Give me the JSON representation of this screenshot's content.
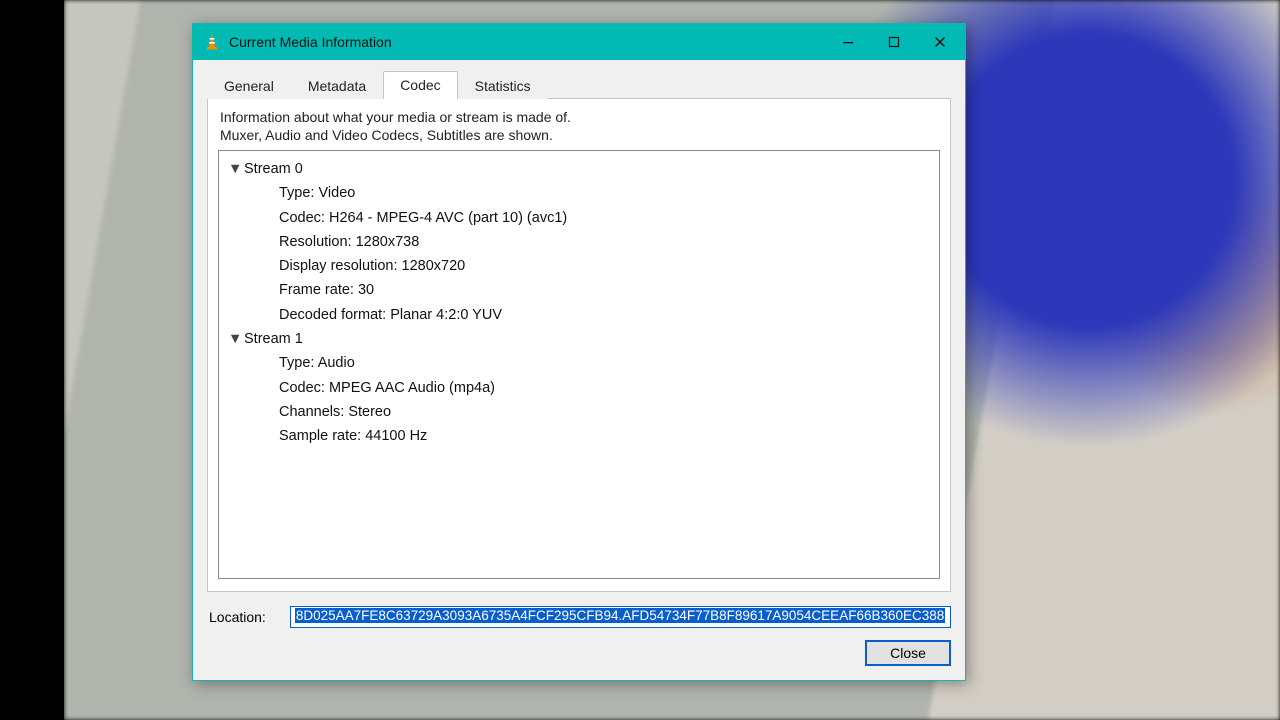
{
  "window": {
    "title": "Current Media Information"
  },
  "tabs": {
    "general": "General",
    "metadata": "Metadata",
    "codec": "Codec",
    "statistics": "Statistics"
  },
  "codec_panel": {
    "description_line1": "Information about what your media or stream is made of.",
    "description_line2": "Muxer, Audio and Video Codecs, Subtitles are shown.",
    "streams": [
      {
        "header": "Stream 0",
        "rows": [
          "Type: Video",
          "Codec: H264 - MPEG-4 AVC (part 10) (avc1)",
          "Resolution: 1280x738",
          "Display resolution: 1280x720",
          "Frame rate: 30",
          "Decoded format: Planar 4:2:0 YUV"
        ]
      },
      {
        "header": "Stream 1",
        "rows": [
          "Type: Audio",
          "Codec: MPEG AAC Audio (mp4a)",
          "Channels: Stereo",
          "Sample rate: 44100 Hz"
        ]
      }
    ]
  },
  "location": {
    "label": "Location:",
    "value": "8D025AA7FE8C63729A3093A6735A4FCF295CFB94.AFD54734F77B8F89617A9054CEEAF66B360EC388"
  },
  "buttons": {
    "close": "Close"
  }
}
